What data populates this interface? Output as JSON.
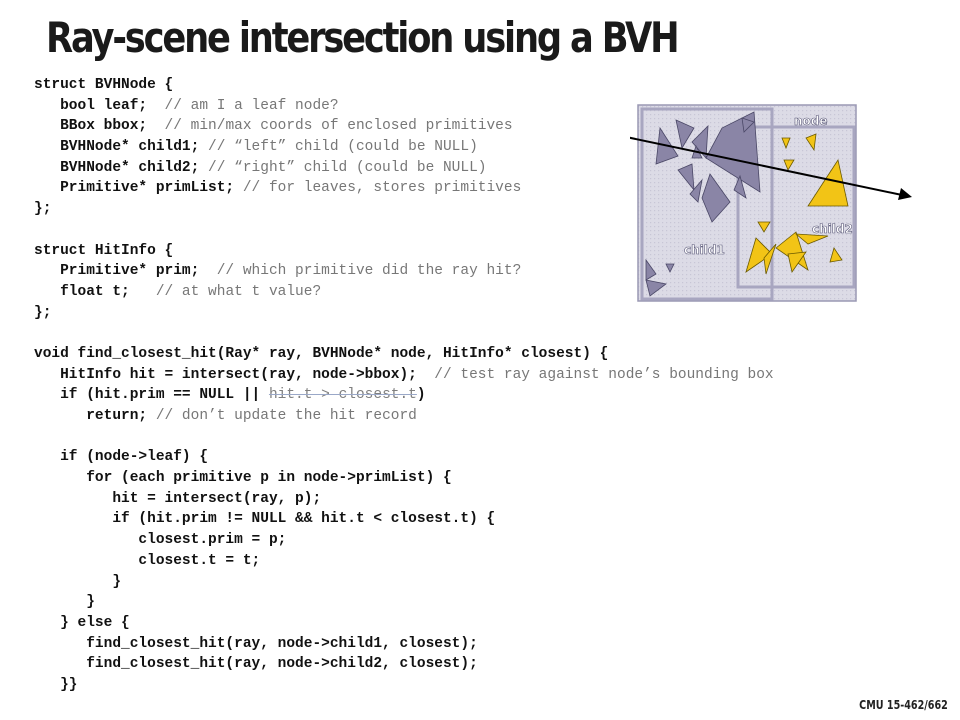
{
  "title": "Ray-scene intersection using a BVH",
  "footer": "CMU 15-462/662",
  "code": {
    "l01": "struct BVHNode {",
    "l02_code": "   bool leaf;  ",
    "l02_comment": "// am I a leaf node?",
    "l03_code": "   BBox bbox;  ",
    "l03_comment": "// min/max coords of enclosed primitives",
    "l04_code": "   BVHNode* child1; ",
    "l04_comment": "// “left” child (could be NULL)",
    "l05_code": "   BVHNode* child2; ",
    "l05_comment": "// “right” child (could be NULL)",
    "l06_code": "   Primitive* primList; ",
    "l06_comment": "// for leaves, stores primitives",
    "l07": "};",
    "l09": "struct HitInfo {",
    "l10_code": "   Primitive* prim;  ",
    "l10_comment": "// which primitive did the ray hit?",
    "l11_code": "   float t;   ",
    "l11_comment": "// at what t value?",
    "l12": "};",
    "l14": "void find_closest_hit(Ray* ray, BVHNode* node, HitInfo* closest) {",
    "l15_code": "   HitInfo hit = intersect(ray, node->bbox);  ",
    "l15_comment": "// test ray against node’s bounding box",
    "l16_pre": "   if (hit.prim == NULL || ",
    "l16_struck": "hit.t > closest.t",
    "l16_post": ")",
    "l17_code": "      return; ",
    "l17_comment": "// don’t update the hit record",
    "l19": "   if (node->leaf) {",
    "l20": "      for (each primitive p in node->primList) {",
    "l21": "         hit = intersect(ray, p);",
    "l22": "         if (hit.prim != NULL && hit.t < closest.t) {",
    "l23": "            closest.prim = p;",
    "l24": "            closest.t = t;",
    "l25": "         }",
    "l26": "      }",
    "l27": "   } else {",
    "l28": "      find_closest_hit(ray, node->child1, closest);",
    "l29": "      find_closest_hit(ray, node->child2, closest);",
    "l30": "   }}"
  },
  "diagram": {
    "node_label": "node",
    "child1_label": "child1",
    "child2_label": "child2",
    "colors": {
      "child1_primitives": "#8a85a6",
      "child2_primitives": "#f2c416",
      "box_fill": "#dcdbe6",
      "box_stroke": "#9a98b4",
      "ray": "#000000"
    }
  }
}
